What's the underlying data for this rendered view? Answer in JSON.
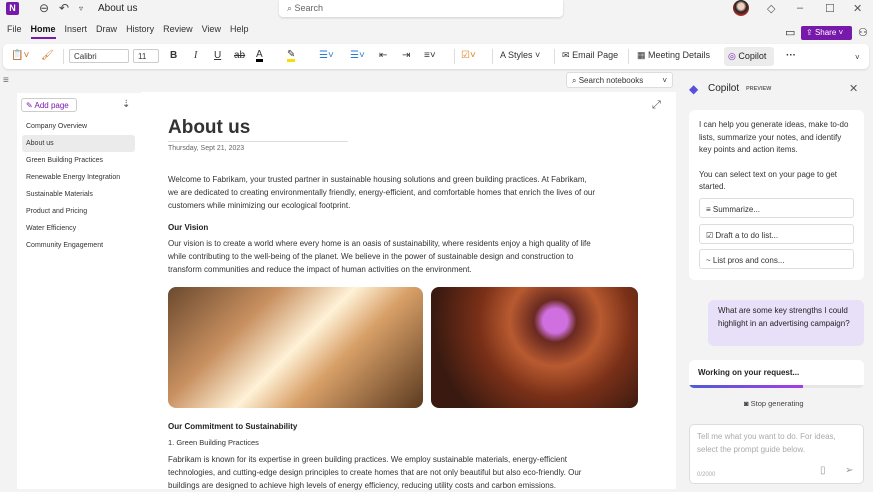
{
  "app": {
    "title": "About us",
    "search_placeholder": "Search"
  },
  "menu": [
    "File",
    "Home",
    "Insert",
    "Draw",
    "History",
    "Review",
    "View",
    "Help"
  ],
  "share_label": "Share",
  "ribbon": {
    "font": "Calibri",
    "size": "11",
    "styles": "Styles",
    "email": "Email Page",
    "meeting": "Meeting Details",
    "copilot": "Copilot",
    "more": "···"
  },
  "search_notebooks": "Search notebooks",
  "sidebar": {
    "add_page": "Add page",
    "pages": [
      "Company Overview",
      "About us",
      "Green Building Practices",
      "Renewable Energy Integration",
      "Sustainable Materials",
      "Product and Pricing",
      "Water Efficiency",
      "Community Engagement"
    ]
  },
  "page": {
    "title": "About us",
    "date": "Thursday, Sept 21, 2023",
    "intro": "Welcome to Fabrikam, your trusted partner in sustainable housing solutions and green building practices. At Fabrikam, we are dedicated to creating environmentally friendly, energy-efficient, and comfortable homes that enrich the lives of our customers while minimizing our ecological footprint.",
    "vision_heading": "Our Vision",
    "vision": "Our vision is to create a world where every home is an oasis of sustainability, where residents enjoy a high quality of life while contributing to the well-being of the planet. We believe in the power of sustainable design and construction to transform communities and reduce the impact of human activities on the environment.",
    "commit_heading": "Our Commitment to Sustainability",
    "item1": "1. Green Building Practices",
    "item1_text": "Fabrikam is known for its expertise in green building practices. We employ sustainable materials, energy-efficient technologies, and cutting-edge design principles to create homes that are not only beautiful but also eco-friendly. Our buildings are designed to achieve high levels of energy efficiency, reducing utility costs and carbon emissions."
  },
  "copilot": {
    "title": "Copilot",
    "badge": "PREVIEW",
    "intro": "I can help you generate ideas, make to-do lists, summarize your notes, and identify key points and action items.",
    "intro2": "You can select text on your page to get started.",
    "prompts": [
      "Summarize...",
      "Draft a to do list...",
      "List pros and cons..."
    ],
    "user_msg": "What are some key strengths I could highlight in an advertising campaign?",
    "working": "Working on your request...",
    "progress": 0.65,
    "stop": "Stop generating",
    "input_placeholder": "Tell me what you want to do. For ideas, select the prompt guide below.",
    "counter": "0/2000"
  }
}
